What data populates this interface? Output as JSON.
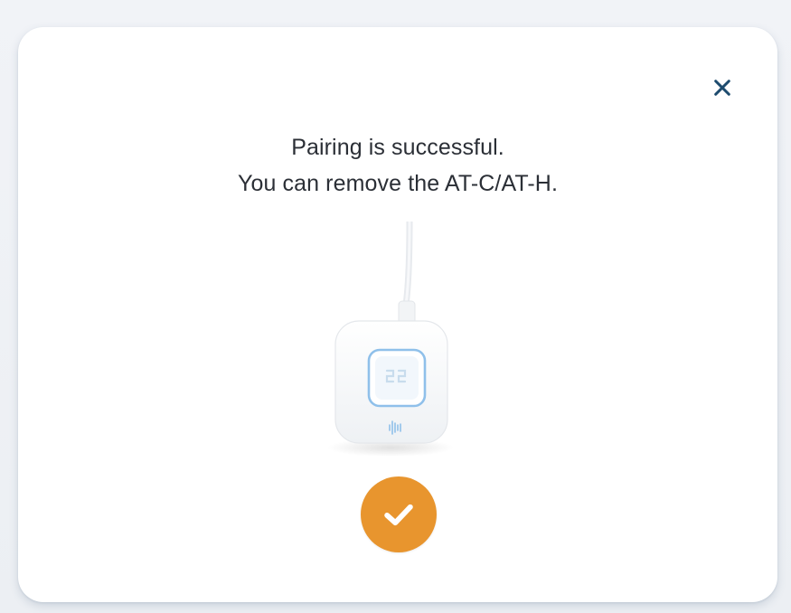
{
  "dialog": {
    "close_icon": "close-icon",
    "message_line_1": "Pairing is successful.",
    "message_line_2": "You can remove the AT-C/AT-H.",
    "device_illustration": "hub-device-illustration",
    "status_icon": "checkmark-icon"
  },
  "colors": {
    "close": "#1d4b6e",
    "text": "#2b2f36",
    "accent_orange": "#e8952e",
    "device_blue": "#8fc0ea"
  }
}
